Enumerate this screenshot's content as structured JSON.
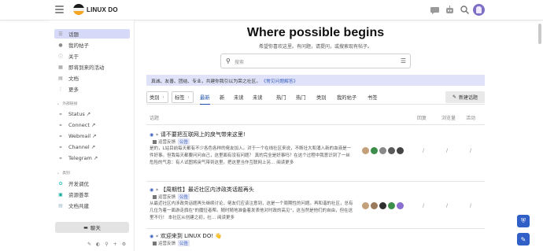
{
  "header": {
    "site_title": "LINUX DO",
    "icons": [
      "chat-bubble-icon",
      "robot-icon",
      "search-icon",
      "user-avatar"
    ]
  },
  "sidebar": {
    "items": [
      {
        "label": "话题",
        "icon": "list-icon",
        "active": true
      },
      {
        "label": "我的帖子",
        "icon": "user-icon"
      },
      {
        "label": "关于",
        "icon": "info-icon"
      },
      {
        "label": "即将到来的活动",
        "icon": "calendar-icon"
      },
      {
        "label": "文档",
        "icon": "document-icon"
      },
      {
        "label": "更多",
        "icon": "more-icon"
      }
    ],
    "external_header": "外部链接",
    "external": [
      {
        "label": "Status ↗",
        "icon": "link-icon"
      },
      {
        "label": "Connect ↗",
        "icon": "link-icon"
      },
      {
        "label": "Webmail ↗",
        "icon": "link-icon"
      },
      {
        "label": "Channel ↗",
        "icon": "link-icon"
      },
      {
        "label": "Telegram ↗",
        "icon": "link-icon"
      }
    ],
    "category_header": "类别",
    "categories": [
      {
        "label": "开发调优",
        "icon": "dev-icon",
        "color": "#32c3c3"
      },
      {
        "label": "资源荟萃",
        "icon": "resource-icon",
        "color": "#12a89d"
      },
      {
        "label": "文档共建",
        "icon": "doc-build-icon",
        "color": "#9cb6c4"
      }
    ],
    "chat_label": "聊天",
    "footer_icons": [
      "edit-icon",
      "theme-icon",
      "wrench-icon",
      "add-icon",
      "settings-icon"
    ]
  },
  "hero": {
    "title": "Where possible begins",
    "subtitle": "希望你喜欢这里。有问题，请提问，或搜索现有帖子。"
  },
  "search": {
    "placeholder": "搜索"
  },
  "banner": {
    "text": "真诚、友善、团结、专业，共建你我引以为荣之社区。",
    "link": "《常见问题解答》"
  },
  "topic_nav": {
    "category_dropdown": "类别",
    "tag_dropdown": "标签",
    "tabs": [
      "最新",
      "新",
      "未读",
      "未读",
      "热门",
      "热门",
      "类别",
      "我的帖子",
      "书签"
    ],
    "active_tab": "最新",
    "new_topic_label": "新建话题"
  },
  "columns": {
    "topic": "话题",
    "replies": "回复",
    "views": "浏览量",
    "activity": "活动"
  },
  "topics": [
    {
      "title": "请不要把互联网上的戾气带来这里!",
      "category": "运营反馈",
      "tag": "公告",
      "excerpt": "是的，L站目前每天都有不少各色各样的佬友加入。对于一个在线社区来说，不断壮大和涌入新的血液是一件好事。但我每天都要问问自己，这里面有没有问题？ 真的完全是好事吗？在这个过程中我意识到了一丝危险的气息：有人试图将戾气带到这里。把这里当作互联网上另… 阅读更多",
      "replies": "/",
      "views": "/",
      "activity": "/",
      "avatar_colors": [
        "#c3a07a",
        "#3c8f4a",
        "#888888",
        "#5a5a5a",
        "#444444"
      ]
    },
    {
      "title": "【周期性】最近社区内涉政类话题再头",
      "category": "运营反馈",
      "tag": "公告",
      "excerpt": "从最近社区内涉政类话题再头继续讨论，佬友们应该注意到，这是一个周期性的问题。再和谐的社区，总有几位为着一面游走旗在\"的魔怔者帮。随时随地准备着发表他对时政的高见\"，这当然是他们的自由，但在这里不行！ 本社区从创建之初，社… 阅读更多",
      "replies": "/",
      "views": "/",
      "activity": "/",
      "avatar_colors": [
        "#c3a07a",
        "#9a7a5a",
        "#2f2f2f",
        "#3c8f4a",
        "#8a6fd0"
      ]
    },
    {
      "title": "欢迎来到 LINUX DO! 👋",
      "category": "运营反馈",
      "tag": "公告",
      "excerpt": "",
      "replies": "",
      "views": "",
      "activity": "",
      "avatar_colors": [
        "#3c8f4a",
        "#c3a07a",
        "#b58a6a",
        "#d06a6a",
        "#6a6a6a"
      ]
    }
  ]
}
